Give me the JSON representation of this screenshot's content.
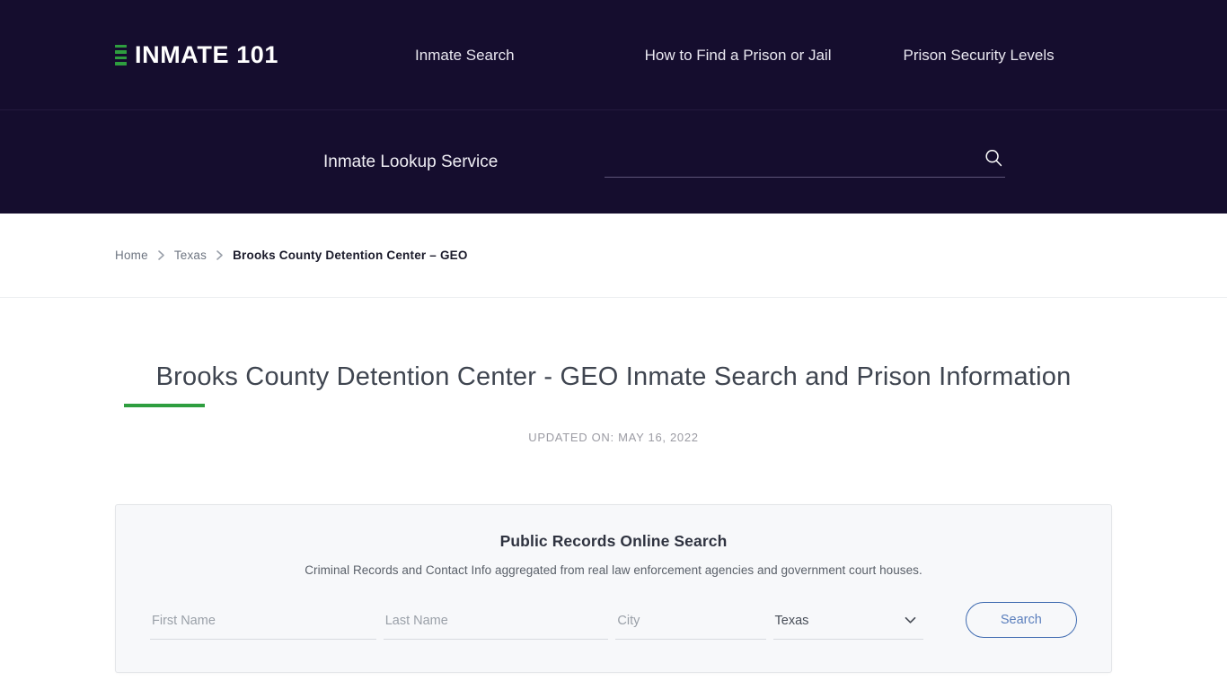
{
  "header": {
    "logo": {
      "text": "INMATE 101",
      "mark_color": "#2e9e3f",
      "icon": "bars-logo-icon"
    },
    "nav": [
      {
        "label": "Inmate Search"
      },
      {
        "label": "How to Find a Prison or Jail"
      },
      {
        "label": "Prison Security Levels"
      }
    ],
    "background_color": "#150d2e"
  },
  "lookup": {
    "label": "Inmate Lookup Service",
    "input_value": "",
    "input_placeholder": "",
    "submit_icon": "search-icon"
  },
  "breadcrumb": {
    "items": [
      {
        "label": "Home",
        "current": false
      },
      {
        "label": "Texas",
        "current": false
      },
      {
        "label": "Brooks County Detention Center – GEO",
        "current": true
      }
    ],
    "separator_icon": "chevron-right-icon"
  },
  "page": {
    "title": "Brooks County Detention Center - GEO Inmate Search and Prison Information",
    "accent_color": "#2e9e3f",
    "updated_on": "UPDATED ON: MAY 16, 2022"
  },
  "records_search": {
    "title": "Public Records Online Search",
    "subtitle": "Criminal Records and Contact Info aggregated from real law enforcement agencies and government court houses.",
    "fields": {
      "first_name": {
        "value": "",
        "placeholder": "First Name"
      },
      "last_name": {
        "value": "",
        "placeholder": "Last Name"
      },
      "city": {
        "value": "",
        "placeholder": "City"
      },
      "state": {
        "selected": "Texas",
        "chevron": "⌄",
        "icon": "chevron-down-icon"
      }
    },
    "submit_label": "Search",
    "submit_border_color": "#3e6ab0"
  }
}
